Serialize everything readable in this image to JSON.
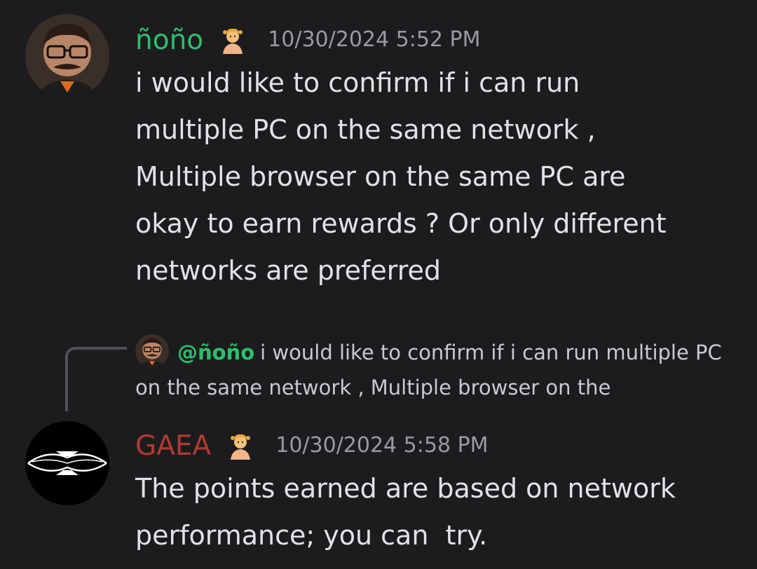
{
  "messages": [
    {
      "username": "ñoño",
      "username_color": "#2dbf6b",
      "role_icon": "person-emoji-icon",
      "timestamp": "10/30/2024 5:52 PM",
      "text": "i would like to confirm if i can run\nmultiple PC on the same network ,\nMultiple browser on the same PC are\nokay to earn rewards ? Or only different\nnetworks are preferred"
    },
    {
      "username": "GAEA",
      "username_color": "#b33a2f",
      "role_icon": "person-emoji-icon",
      "timestamp": "10/30/2024 5:58 PM",
      "text": "The points earned are based on network\nperformance; you can  try.",
      "reply": {
        "mention": "@ñoño",
        "preview": "i would like to confirm if i can run multiple PC on the same network , Multiple browser on the"
      }
    }
  ]
}
